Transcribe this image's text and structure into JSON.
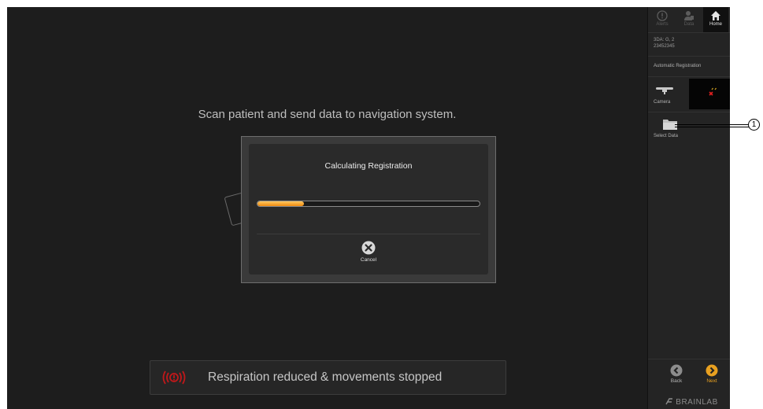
{
  "main": {
    "instruction": "Scan patient and send data to navigation system."
  },
  "dialog": {
    "title": "Calculating Registration",
    "progress_percent": 21,
    "cancel_label": "Cancel",
    "cancel_icon": "x-circle-icon"
  },
  "status": {
    "icon": "alert-waves-icon",
    "icon_color": "#c0181a",
    "text": "Respiration reduced & movements stopped"
  },
  "sidebar": {
    "tabs": [
      {
        "label": "Alerts",
        "icon": "alert-icon",
        "active": false
      },
      {
        "label": "Data",
        "icon": "data-icon",
        "active": false
      },
      {
        "label": "Home",
        "icon": "home-icon",
        "active": true
      }
    ],
    "patient": {
      "line1": "3DA: G, 2",
      "line2": "23452345"
    },
    "workflow": "Automatic Registration",
    "camera": {
      "label": "Camera",
      "icon": "camera-icon"
    },
    "select_data": {
      "label": "Select Data",
      "icon": "folder-icon"
    },
    "back": {
      "label": "Back",
      "icon": "chevron-left-icon"
    },
    "next": {
      "label": "Next",
      "icon": "chevron-right-icon",
      "color": "#e8a020"
    },
    "brand": "BRAINLAB"
  },
  "callout": {
    "number": "1"
  },
  "colors": {
    "accent": "#f39a1c",
    "background": "#1d1d1d"
  }
}
